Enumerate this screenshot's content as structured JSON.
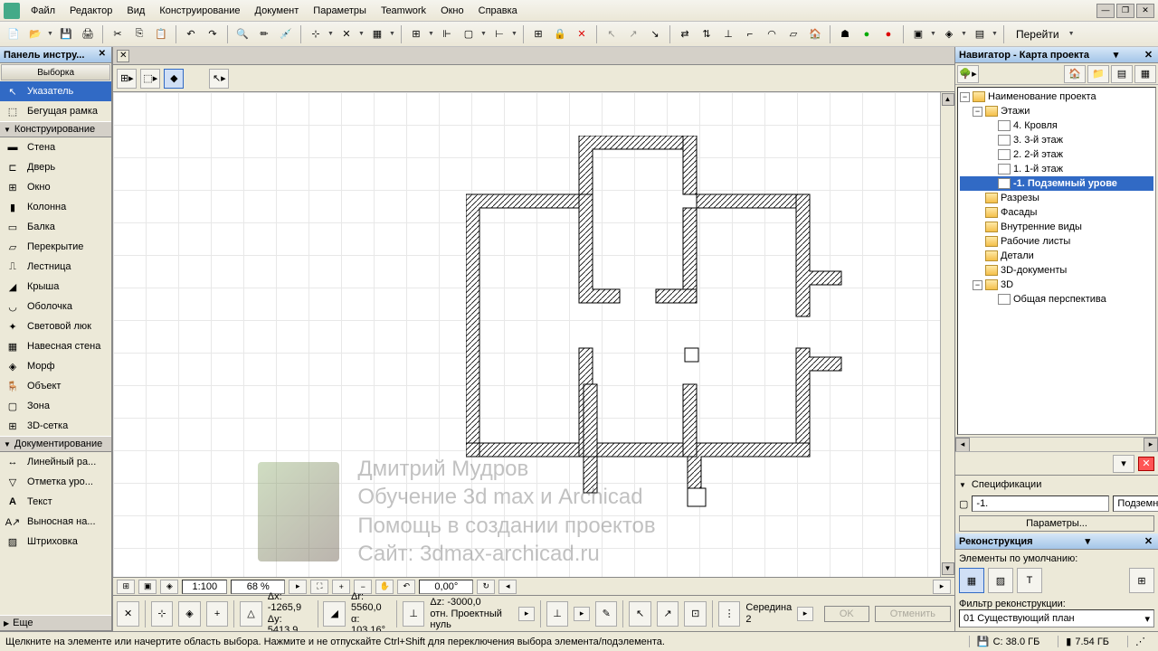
{
  "menu": {
    "items": [
      "Файл",
      "Редактор",
      "Вид",
      "Конструирование",
      "Документ",
      "Параметры",
      "Teamwork",
      "Окно",
      "Справка"
    ]
  },
  "toolbar": {
    "goto": "Перейти"
  },
  "toolbox": {
    "title": "Панель инстру...",
    "group_btn": "Выборка",
    "sections": {
      "pointer": "Указатель",
      "marquee": "Бегущая рамка",
      "construction": "Конструирование",
      "documentation": "Документирование",
      "more": "Еще"
    },
    "tools": {
      "wall": "Стена",
      "door": "Дверь",
      "window": "Окно",
      "column": "Колонна",
      "beam": "Балка",
      "slab": "Перекрытие",
      "stair": "Лестница",
      "roof": "Крыша",
      "shell": "Оболочка",
      "skylight": "Световой люк",
      "curtain": "Навесная стена",
      "morph": "Морф",
      "object": "Объект",
      "zone": "Зона",
      "mesh": "3D-сетка",
      "linear": "Линейный ра...",
      "level": "Отметка уро...",
      "text": "Текст",
      "leader": "Выносная на...",
      "hatch": "Штриховка"
    }
  },
  "navigator": {
    "title": "Навигатор - Карта проекта",
    "project": "Наименование проекта",
    "stories_label": "Этажи",
    "stories": [
      "4. Кровля",
      "3. 3-й этаж",
      "2. 2-й этаж",
      "1. 1-й этаж",
      "-1. Подземный урове"
    ],
    "sections": "Разрезы",
    "elevations": "Фасады",
    "interior": "Внутренние виды",
    "worksheets": "Рабочие листы",
    "details": "Детали",
    "docs3d": "3D-документы",
    "view3d": "3D",
    "perspective": "Общая перспектива"
  },
  "spec": {
    "title": "Спецификации",
    "id": "-1.",
    "name": "Подземный уровень",
    "params_btn": "Параметры..."
  },
  "recon": {
    "title": "Реконструкция",
    "default_label": "Элементы по умолчанию:",
    "filter_label": "Фильтр реконструкции:",
    "filter_value": "01 Существующий план"
  },
  "viewbar": {
    "scale": "1:100",
    "zoom": "68 %",
    "angle": "0,00°"
  },
  "coords": {
    "dx": "Δx:  -1265,9",
    "dy": "Δy:  5413,9",
    "dr": "Δr:  5560,0",
    "da": "α:  103,16°",
    "dz": "Δz:  -3000,0",
    "ref": "отн. Проектный нуль",
    "mid": "Середина",
    "mid_n": "2",
    "ok": "OK",
    "cancel": "Отменить"
  },
  "status": {
    "hint": "Щелкните на элементе или начертите область выбора. Нажмите и не отпускайте Ctrl+Shift для переключения выбора элемента/подэлемента.",
    "mem1": "C: 38.0 ГБ",
    "mem2": "7.54 ГБ"
  },
  "watermark": {
    "line1": "Дмитрий Мудров",
    "line2": "Обучение 3d max и Archicad",
    "line3": "Помощь в создании проектов",
    "line4": "Сайт: 3dmax-archicad.ru"
  }
}
